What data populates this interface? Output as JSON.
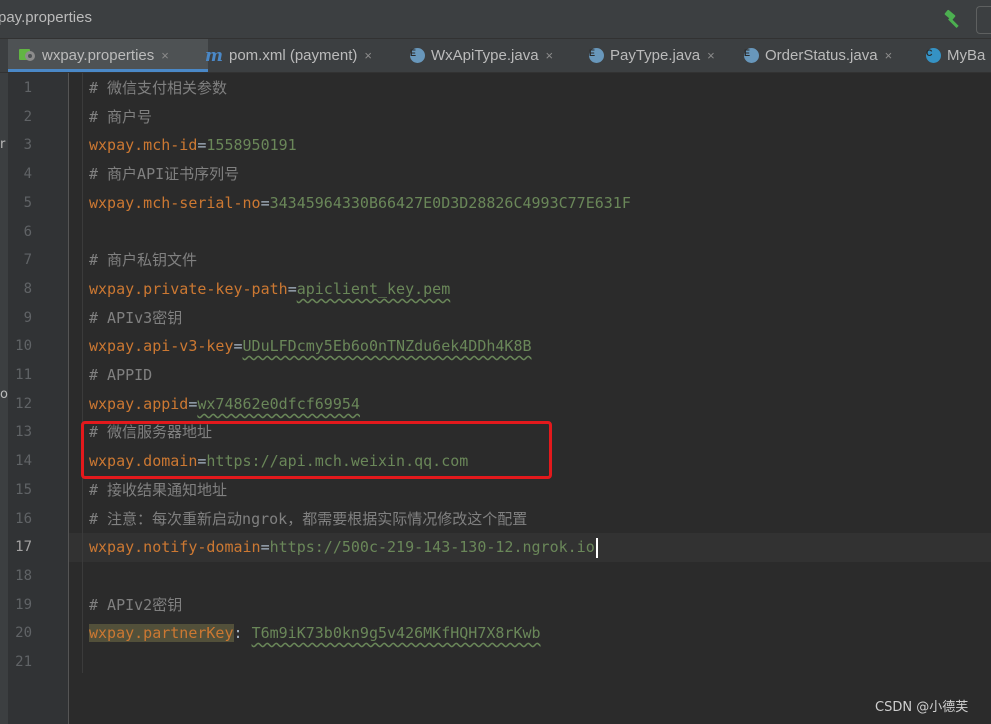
{
  "window": {
    "title": "pay.properties"
  },
  "toolbar": {
    "build_icon": "hammer-icon"
  },
  "tabs": [
    {
      "label": "wxpay.properties",
      "icon": "properties-icon",
      "active": true,
      "close": "×"
    },
    {
      "label": "pom.xml (payment)",
      "icon": "maven-icon",
      "icon_text": "m",
      "close": "×"
    },
    {
      "label": "WxApiType.java",
      "icon": "enum-icon",
      "icon_text": "E",
      "close": "×"
    },
    {
      "label": "PayType.java",
      "icon": "enum-icon",
      "icon_text": "E",
      "close": "×"
    },
    {
      "label": "OrderStatus.java",
      "icon": "enum-icon",
      "icon_text": "E",
      "close": "×"
    },
    {
      "label": "MyBa",
      "icon": "class-icon",
      "icon_text": "C"
    }
  ],
  "side_strip": {
    "glyph_1": "r",
    "glyph_2": "o"
  },
  "editor": {
    "current_line": 17,
    "line_numbers": [
      "1",
      "2",
      "3",
      "4",
      "5",
      "6",
      "7",
      "8",
      "9",
      "10",
      "11",
      "12",
      "13",
      "14",
      "15",
      "16",
      "17",
      "18",
      "19",
      "20",
      "21"
    ],
    "lines": [
      {
        "comment": "# 微信支付相关参数"
      },
      {
        "comment": "# 商户号"
      },
      {
        "key": "wxpay.mch-id",
        "sep": "=",
        "value": "1558950191"
      },
      {
        "comment": "# 商户API证书序列号"
      },
      {
        "key": "wxpay.mch-serial-no",
        "sep": "=",
        "value": "34345964330B66427E0D3D28826C4993C77E631F"
      },
      {},
      {
        "comment": "# 商户私钥文件"
      },
      {
        "key": "wxpay.private-key-path",
        "sep": "=",
        "value": "apiclient_key.pem"
      },
      {
        "comment": "# APIv3密钥"
      },
      {
        "key": "wxpay.api-v3-key",
        "sep": "=",
        "value": "UDuLFDcmy5Eb6o0nTNZdu6ek4DDh4K8B"
      },
      {
        "comment": "# APPID"
      },
      {
        "key": "wxpay.appid",
        "sep": "=",
        "value": "wx74862e0dfcf69954"
      },
      {
        "comment": "# 微信服务器地址"
      },
      {
        "key": "wxpay.domain",
        "sep": "=",
        "value": "https://api.mch.weixin.qq.com"
      },
      {
        "comment": "# 接收结果通知地址"
      },
      {
        "comment": "# 注意：每次重新启动ngrok，都需要根据实际情况修改这个配置"
      },
      {
        "key": "wxpay.notify-domain",
        "sep": "=",
        "value": "https://500c-219-143-130-12.ngrok.io"
      },
      {},
      {
        "comment": "# APIv2密钥"
      },
      {
        "key": "wxpay.partnerKey",
        "sep": ": ",
        "value": "T6m9iK73b0kn9g5v426MKfHQH7X8rKwb"
      },
      {}
    ]
  },
  "highlight": {
    "color": "#e3191c"
  },
  "watermark": "CSDN @小德芙"
}
